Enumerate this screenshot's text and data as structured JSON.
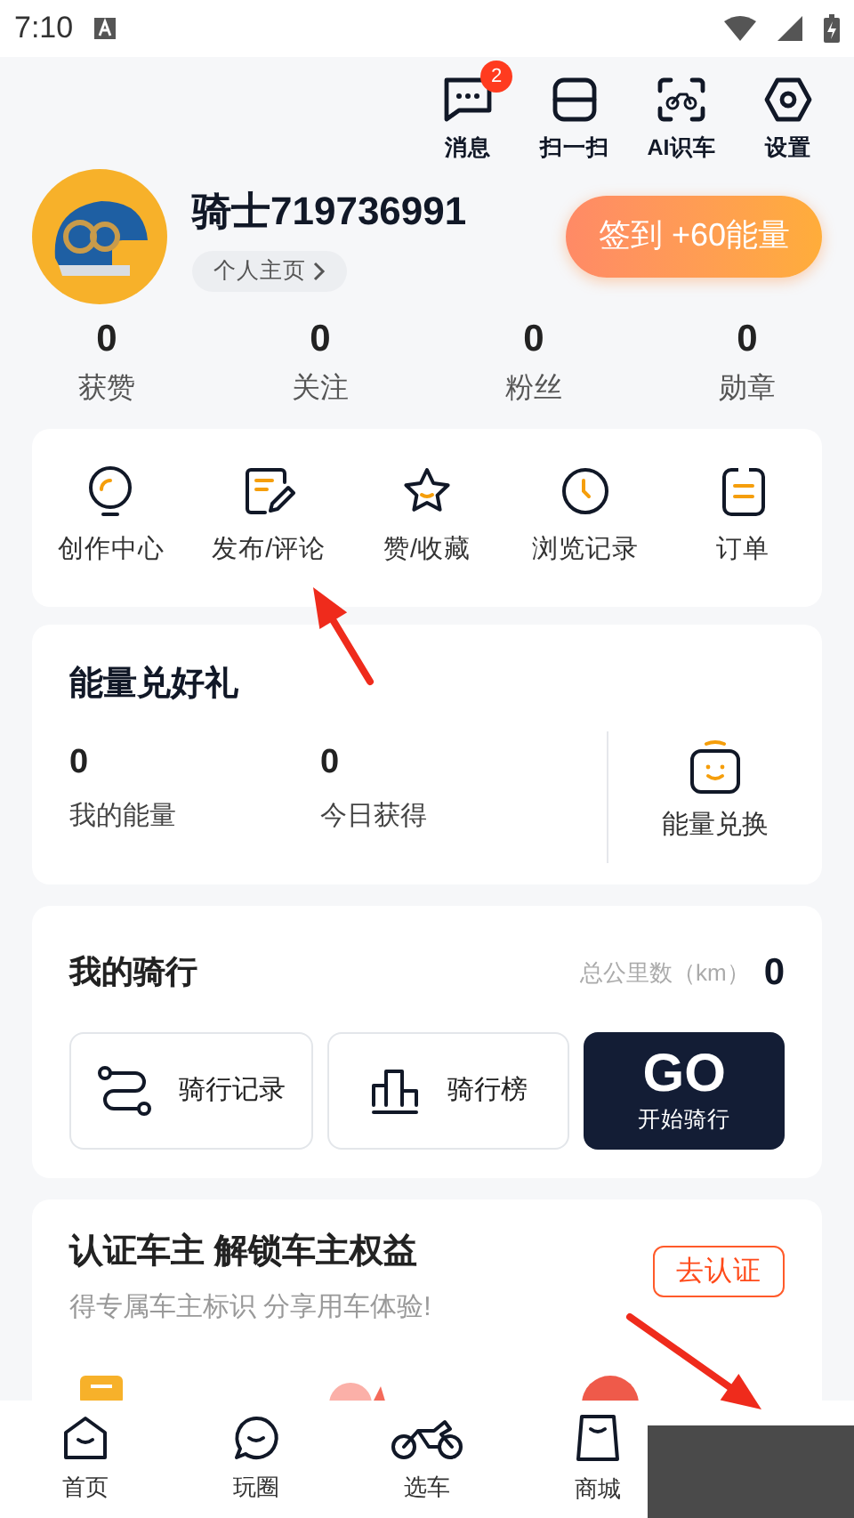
{
  "status_bar": {
    "time": "7:10"
  },
  "top_actions": [
    {
      "kind": "message",
      "label": "消息",
      "badge": "2"
    },
    {
      "kind": "scan",
      "label": "扫一扫"
    },
    {
      "kind": "ai",
      "label": "AI识车"
    },
    {
      "kind": "settings",
      "label": "设置"
    }
  ],
  "profile": {
    "name": "骑士719736991",
    "homepage_link": "个人主页",
    "checkin_button": "签到 +60能量"
  },
  "stats": [
    {
      "value": "0",
      "label": "获赞"
    },
    {
      "value": "0",
      "label": "关注"
    },
    {
      "value": "0",
      "label": "粉丝"
    },
    {
      "value": "0",
      "label": "勋章"
    }
  ],
  "shortcuts": [
    {
      "kind": "bulb",
      "label": "创作中心"
    },
    {
      "kind": "edit",
      "label": "发布/评论"
    },
    {
      "kind": "star",
      "label": "赞/收藏"
    },
    {
      "kind": "clock",
      "label": "浏览记录"
    },
    {
      "kind": "order",
      "label": "订单"
    }
  ],
  "energy": {
    "title": "能量兑好礼",
    "items": [
      {
        "value": "0",
        "label": "我的能量"
      },
      {
        "value": "0",
        "label": "今日获得"
      }
    ],
    "exchange": "能量兑换"
  },
  "riding": {
    "title": "我的骑行",
    "total_label": "总公里数（km）",
    "total_value": "0",
    "buttons": [
      {
        "kind": "route",
        "label": "骑行记录"
      },
      {
        "kind": "rank",
        "label": "骑行榜"
      }
    ],
    "go": {
      "title": "GO",
      "subtitle": "开始骑行"
    }
  },
  "owner": {
    "title": "认证车主 解锁车主权益",
    "subtitle": "得专属车主标识 分享用车体验!",
    "button": "去认证"
  },
  "bottom_nav": [
    {
      "kind": "home",
      "label": "首页"
    },
    {
      "kind": "chat",
      "label": "玩圈"
    },
    {
      "kind": "moto",
      "label": "选车"
    },
    {
      "kind": "shop",
      "label": "商城"
    }
  ]
}
